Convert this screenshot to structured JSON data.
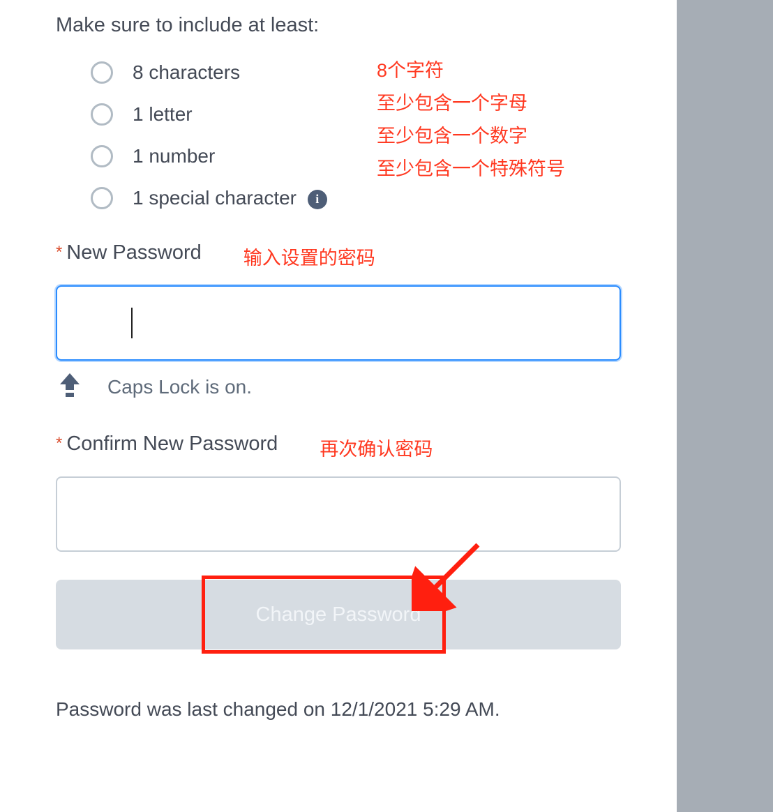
{
  "intro": "Make sure to include at least:",
  "requirements": [
    {
      "label": "8 characters"
    },
    {
      "label": "1 letter"
    },
    {
      "label": "1 number"
    },
    {
      "label": "1 special character"
    }
  ],
  "req_annotations": [
    "8个字符",
    "至少包含一个字母",
    "至少包含一个数字",
    "至少包含一个特殊符号"
  ],
  "fields": {
    "new_password": {
      "label": "New Password",
      "annotation": "输入设置的密码",
      "value": ""
    },
    "confirm_password": {
      "label": "Confirm New Password",
      "annotation": "再次确认密码",
      "value": ""
    }
  },
  "caps_lock_text": "Caps Lock is on.",
  "button_label": "Change Password",
  "footer": "Password was last changed on 12/1/2021 5:29 AM.",
  "colors": {
    "annotation_red": "#ff3820",
    "focus_blue": "#2a8cff",
    "button_bg": "#d6dce2"
  }
}
